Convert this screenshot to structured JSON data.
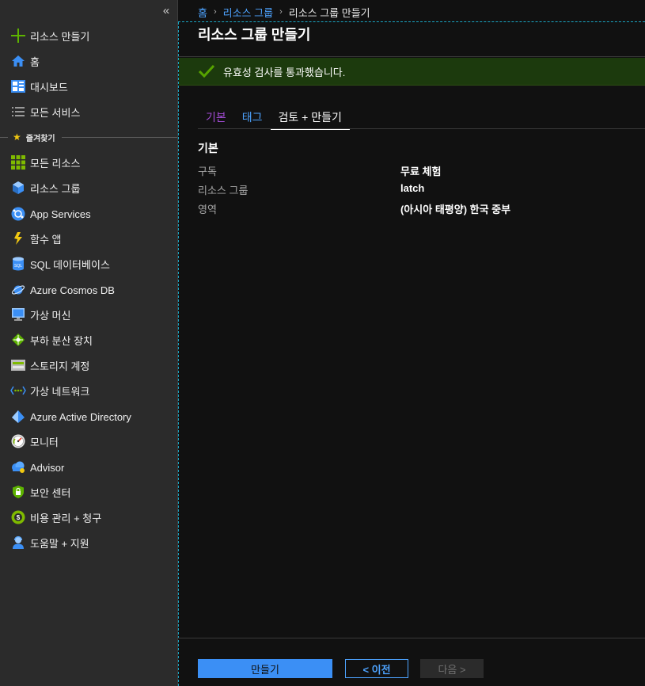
{
  "sidebar": {
    "collapse_glyph": "«",
    "create_resource": "리소스 만들기",
    "home": "홈",
    "dashboard": "대시보드",
    "all_services": "모든 서비스",
    "favorites_label": "즐겨찾기",
    "favorites": [
      {
        "label": "모든 리소스",
        "icon": "grid-icon"
      },
      {
        "label": "리소스 그룹",
        "icon": "cube-icon"
      },
      {
        "label": "App Services",
        "icon": "globe-icon"
      },
      {
        "label": "함수 앱",
        "icon": "lightning-icon"
      },
      {
        "label": "SQL 데이터베이스",
        "icon": "sql-database-icon"
      },
      {
        "label": "Azure Cosmos DB",
        "icon": "planet-icon"
      },
      {
        "label": "가상 머신",
        "icon": "monitor-icon"
      },
      {
        "label": "부하 분산 장치",
        "icon": "load-balancer-icon"
      },
      {
        "label": "스토리지 계정",
        "icon": "storage-icon"
      },
      {
        "label": "가상 네트워크",
        "icon": "network-icon"
      },
      {
        "label": "Azure Active Directory",
        "icon": "diamond-icon"
      },
      {
        "label": "모니터",
        "icon": "gauge-icon"
      },
      {
        "label": "Advisor",
        "icon": "cloud-icon"
      },
      {
        "label": "보안 센터",
        "icon": "shield-lock-icon"
      },
      {
        "label": "비용 관리 + 청구",
        "icon": "coin-icon"
      },
      {
        "label": "도움말 + 지원",
        "icon": "support-person-icon"
      }
    ]
  },
  "breadcrumb": {
    "home": "홈",
    "resource_groups": "리소스 그룹",
    "current": "리소스 그룹 만들기",
    "separator": "›"
  },
  "page": {
    "title": "리소스 그룹 만들기",
    "validation_message": "유효성 검사를 통과했습니다."
  },
  "tabs": [
    "기본",
    "태그",
    "검토 + 만들기"
  ],
  "basics": {
    "title": "기본",
    "rows": [
      {
        "key": "구독",
        "value": "무료 체험"
      },
      {
        "key": "리소스 그룹",
        "value": "latch"
      },
      {
        "key": "영역",
        "value": "(아시아 태평양) 한국 중부"
      }
    ]
  },
  "footer": {
    "create": "만들기",
    "previous": "< 이전",
    "next": "다음 >"
  },
  "colors": {
    "link": "#4da3ff",
    "success_banner": "#1c3a0d",
    "success_check": "#57a300",
    "primary_button": "#3b8ff5",
    "tab_visited": "#a34cd6"
  }
}
